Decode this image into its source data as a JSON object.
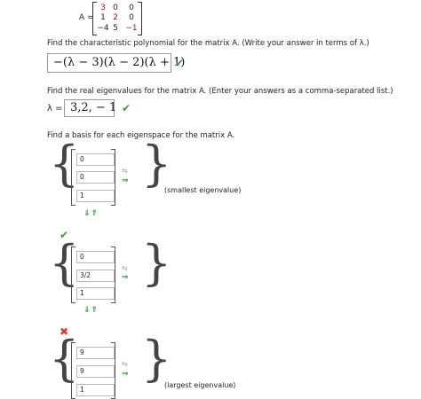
{
  "matrix": {
    "label": "A =",
    "rows": [
      [
        {
          "v": "3",
          "red": true
        },
        {
          "v": "0",
          "red": false
        },
        {
          "v": "0",
          "red": false
        }
      ],
      [
        {
          "v": "1",
          "red": false
        },
        {
          "v": "2",
          "red": true
        },
        {
          "v": "0",
          "red": false
        }
      ],
      [
        {
          "v": "−4",
          "red": false
        },
        {
          "v": "5",
          "red": false
        },
        {
          "v": "−1",
          "red": true
        }
      ]
    ]
  },
  "q1": {
    "prompt": "Find the characteristic polynomial for the matrix A. (Write your answer in terms of λ.)",
    "answer": "−(λ − 3)(λ − 2)(λ + 1)",
    "status_icon": "check-icon"
  },
  "q2": {
    "prompt": "Find the real eigenvalues for the matrix A. (Enter your answers as a comma-separated list.)",
    "lambda_label": "λ =",
    "answer": "3,2, − 1",
    "status_icon": "check-icon"
  },
  "q3": {
    "prompt": "Find a basis for each eigenspace for the matrix A.",
    "groups": [
      {
        "inputs": [
          "0",
          "0",
          "1"
        ],
        "status": "",
        "label": "(smallest eigenvalue)"
      },
      {
        "inputs": [
          "0",
          "3/2",
          "1"
        ],
        "status": "check-icon",
        "label": ""
      },
      {
        "inputs": [
          "9",
          "9",
          "1"
        ],
        "status": "cross-icon",
        "label": "(largest eigenvalue)"
      }
    ],
    "swap_glyph": "⇆",
    "arrow_glyph": "⇒",
    "updown_glyph": "⇓⇑",
    "check_glyph": "✔",
    "cross_glyph": "✖"
  },
  "colors": {
    "red_entry": "#d0021b",
    "check": "#3a9a3a",
    "cross": "#e0382b"
  }
}
